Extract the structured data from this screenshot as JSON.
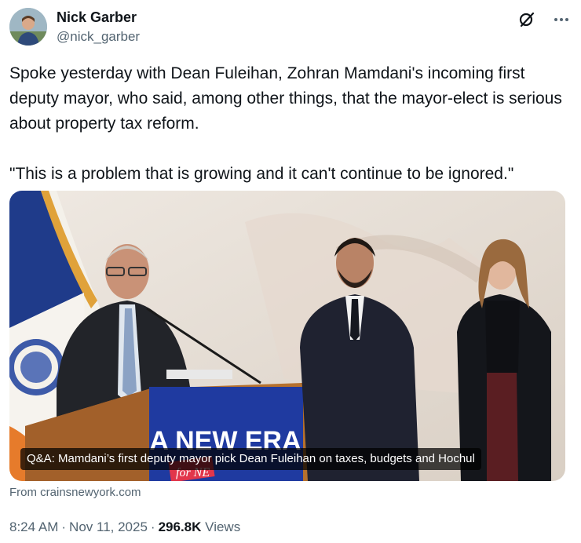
{
  "author": {
    "display_name": "Nick Garber",
    "handle": "@nick_garber"
  },
  "actions": {
    "grok_icon": "grok-icon",
    "more_icon": "more-icon"
  },
  "tweet": {
    "paragraph_1": "Spoke yesterday with Dean Fuleihan, Zohran Mamdani's incoming first deputy mayor, who said, among other things, that the mayor-elect is serious about property tax reform.",
    "paragraph_2": "\"This is a problem that is growing and it can't continue to be ignored.\""
  },
  "media": {
    "caption": "Q&A: Mamdani’s first deputy mayor pick Dean Fuleihan on taxes, budgets and Hochul",
    "podium_sign_line1": "A NEW ERA",
    "podium_sign_line2": "for NE"
  },
  "source": "From crainsnewyork.com",
  "meta": {
    "time": "8:24 AM",
    "date": "Nov 11, 2025",
    "views_count": "296.8K",
    "views_label": "Views",
    "separator": "·"
  },
  "colors": {
    "text": "#0f1419",
    "secondary": "#536471",
    "podium_blue": "#1f3aa0",
    "podium_red": "#e2364b"
  }
}
